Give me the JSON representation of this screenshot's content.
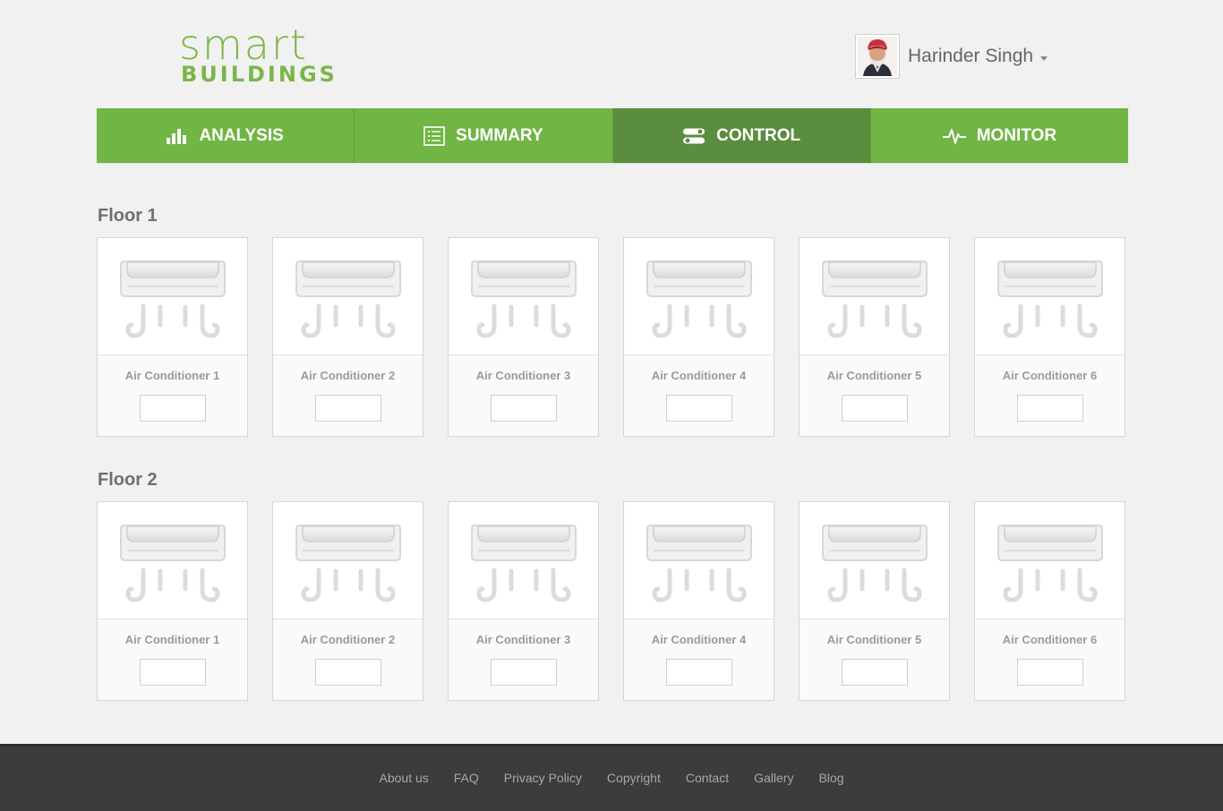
{
  "brand": {
    "top": "smart",
    "bottom": "BUILDINGS",
    "color": "#7ab648"
  },
  "user": {
    "name": "Harinder Singh"
  },
  "nav": {
    "tabs": [
      {
        "label": "ANALYSIS",
        "icon": "bar-chart-icon",
        "active": false
      },
      {
        "label": "SUMMARY",
        "icon": "list-icon",
        "active": false
      },
      {
        "label": "CONTROL",
        "icon": "toggles-icon",
        "active": true
      },
      {
        "label": "MONITOR",
        "icon": "pulse-icon",
        "active": false
      }
    ],
    "color": "#71b545",
    "active_color": "#5a8d3d"
  },
  "floors": [
    {
      "title": "Floor 1",
      "units": [
        {
          "label": "Air Conditioner 1",
          "value": ""
        },
        {
          "label": "Air Conditioner 2",
          "value": ""
        },
        {
          "label": "Air Conditioner 3",
          "value": ""
        },
        {
          "label": "Air Conditioner 4",
          "value": ""
        },
        {
          "label": "Air Conditioner 5",
          "value": ""
        },
        {
          "label": "Air Conditioner 6",
          "value": ""
        }
      ]
    },
    {
      "title": "Floor 2",
      "units": [
        {
          "label": "Air Conditioner 1",
          "value": ""
        },
        {
          "label": "Air Conditioner 2",
          "value": ""
        },
        {
          "label": "Air Conditioner 3",
          "value": ""
        },
        {
          "label": "Air Conditioner 4",
          "value": ""
        },
        {
          "label": "Air Conditioner 5",
          "value": ""
        },
        {
          "label": "Air Conditioner 6",
          "value": ""
        }
      ]
    }
  ],
  "footer": {
    "links": [
      "About us",
      "FAQ",
      "Privacy Policy",
      "Copyright",
      "Contact",
      "Gallery",
      "Blog"
    ]
  }
}
